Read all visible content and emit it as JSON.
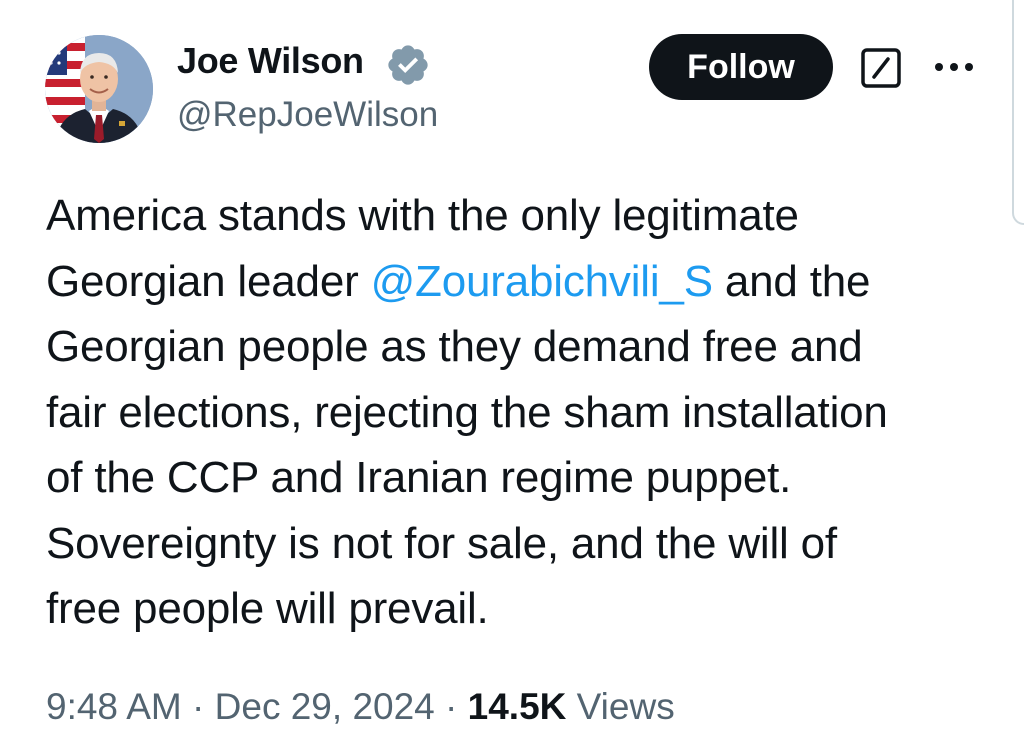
{
  "author": {
    "display_name": "Joe Wilson",
    "handle": "@RepJoeWilson",
    "verified": true
  },
  "actions": {
    "follow_label": "Follow"
  },
  "icons": {
    "verified": "verified-badge-icon",
    "grok": "grok-icon",
    "more": "more-options-icon"
  },
  "tweet": {
    "line1": "America stands with the only legitimate",
    "line2_before": "Georgian leader ",
    "mention": "@Zourabichvili_S",
    "line2_after": " and the",
    "line3": "Georgian people as they demand free and",
    "line4": "fair elections, rejecting the sham installation",
    "line5": "of the CCP and Iranian regime puppet.",
    "line6": "Sovereignty is not for sale, and the will of",
    "line7": "free people will prevail."
  },
  "meta": {
    "time": "9:48 AM",
    "separator": " · ",
    "date": "Dec 29, 2024",
    "views_count": "14.5K",
    "views_label": " Views"
  },
  "colors": {
    "text": "#0f1419",
    "secondary": "#536471",
    "link": "#1d9bf0",
    "follow_bg": "#0f1419",
    "verified_badge": "#829aab"
  }
}
